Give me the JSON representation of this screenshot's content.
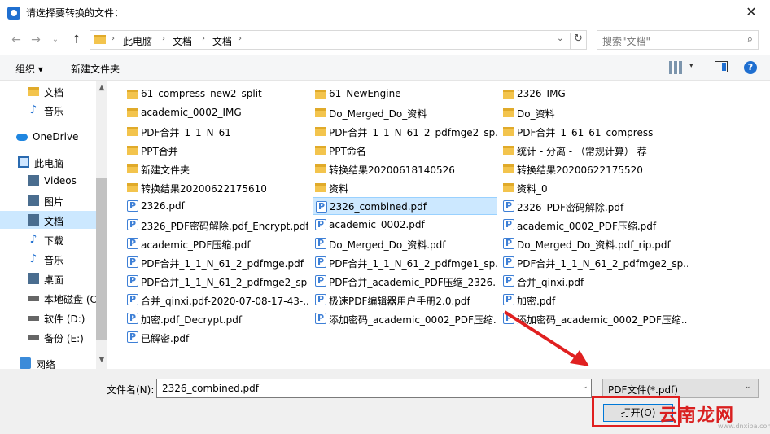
{
  "window": {
    "title": "请选择要转换的文件：",
    "close": "✕"
  },
  "address": {
    "crumbs": [
      "此电脑",
      "文档",
      "文档"
    ],
    "sep": "›",
    "dropdown": "⌄",
    "refresh": "↻"
  },
  "search": {
    "placeholder": "搜索\"文档\"",
    "icon": "⌕"
  },
  "toolbar": {
    "organize": "组织 ▾",
    "new_folder": "新建文件夹",
    "view_dd": "▾",
    "help": "?"
  },
  "nav": {
    "back": "←",
    "forward": "→",
    "up_dd": "⌄",
    "up": "↑"
  },
  "sidebar": {
    "items": [
      {
        "label": "文档",
        "icon": "folder-icon",
        "kind": "folder"
      },
      {
        "label": "音乐",
        "icon": "music-icon",
        "kind": "note"
      },
      {
        "label": "OneDrive",
        "icon": "cloud-icon",
        "kind": "cloud"
      },
      {
        "label": "此电脑",
        "icon": "computer-icon",
        "kind": "pc"
      },
      {
        "label": "Videos",
        "icon": "video-icon",
        "kind": "box"
      },
      {
        "label": "图片",
        "icon": "picture-icon",
        "kind": "box"
      },
      {
        "label": "文档",
        "icon": "document-icon",
        "kind": "box"
      },
      {
        "label": "下载",
        "icon": "download-icon",
        "kind": "note"
      },
      {
        "label": "音乐",
        "icon": "music-icon",
        "kind": "note"
      },
      {
        "label": "桌面",
        "icon": "desktop-icon",
        "kind": "box"
      },
      {
        "label": "本地磁盘 (C",
        "icon": "disk-icon",
        "kind": "disk"
      },
      {
        "label": "软件 (D:)",
        "icon": "disk-icon",
        "kind": "disk"
      },
      {
        "label": "备份 (E:)",
        "icon": "disk-icon",
        "kind": "disk"
      },
      {
        "label": "网络",
        "icon": "network-icon",
        "kind": "net"
      }
    ],
    "selected_index": 6
  },
  "files": {
    "col1": [
      {
        "name": "61_compress_new2_split",
        "type": "folder"
      },
      {
        "name": "academic_0002_IMG",
        "type": "folder"
      },
      {
        "name": "PDF合并_1_1_N_61",
        "type": "folder"
      },
      {
        "name": "PPT合并",
        "type": "folder"
      },
      {
        "name": "新建文件夹",
        "type": "folder"
      },
      {
        "name": "转换结果20200622175610",
        "type": "folder"
      },
      {
        "name": "2326.pdf",
        "type": "pdf"
      },
      {
        "name": "2326_PDF密码解除.pdf_Encrypt.pdf",
        "type": "pdf"
      },
      {
        "name": "academic_PDF压缩.pdf",
        "type": "pdf"
      },
      {
        "name": "PDF合并_1_1_N_61_2_pdfmge.pdf",
        "type": "pdf"
      },
      {
        "name": "PDF合并_1_1_N_61_2_pdfmge2_sp...",
        "type": "pdf"
      },
      {
        "name": "合并_qinxi.pdf-2020-07-08-17-43-...",
        "type": "pdf"
      },
      {
        "name": "加密.pdf_Decrypt.pdf",
        "type": "pdf"
      },
      {
        "name": "已解密.pdf",
        "type": "pdf"
      }
    ],
    "col2": [
      {
        "name": "61_NewEngine",
        "type": "folder"
      },
      {
        "name": "Do_Merged_Do_资料",
        "type": "folder"
      },
      {
        "name": "PDF合并_1_1_N_61_2_pdfmge2_sp...",
        "type": "folder"
      },
      {
        "name": "PPT命名",
        "type": "folder"
      },
      {
        "name": "转换结果20200618140526",
        "type": "folder"
      },
      {
        "name": "资料",
        "type": "folder"
      },
      {
        "name": "2326_combined.pdf",
        "type": "pdf",
        "selected": true
      },
      {
        "name": "academic_0002.pdf",
        "type": "pdf"
      },
      {
        "name": "Do_Merged_Do_资料.pdf",
        "type": "pdf"
      },
      {
        "name": "PDF合并_1_1_N_61_2_pdfmge1_sp...",
        "type": "pdf"
      },
      {
        "name": "PDF合并_academic_PDF压缩_2326...",
        "type": "pdf"
      },
      {
        "name": "极速PDF编辑器用户手册2.0.pdf",
        "type": "pdf"
      },
      {
        "name": "添加密码_academic_0002_PDF压缩...",
        "type": "pdf"
      }
    ],
    "col3": [
      {
        "name": "2326_IMG",
        "type": "folder"
      },
      {
        "name": "Do_资料",
        "type": "folder"
      },
      {
        "name": "PDF合并_1_61_61_compress",
        "type": "folder"
      },
      {
        "name": "统计 - 分离 - （常规计算） 荐",
        "type": "folder"
      },
      {
        "name": "转换结果20200622175520",
        "type": "folder"
      },
      {
        "name": "资料_0",
        "type": "folder"
      },
      {
        "name": "2326_PDF密码解除.pdf",
        "type": "pdf"
      },
      {
        "name": "academic_0002_PDF压缩.pdf",
        "type": "pdf"
      },
      {
        "name": "Do_Merged_Do_资料.pdf_rip.pdf",
        "type": "pdf"
      },
      {
        "name": "PDF合并_1_1_N_61_2_pdfmge2_sp...",
        "type": "pdf"
      },
      {
        "name": "合并_qinxi.pdf",
        "type": "pdf"
      },
      {
        "name": "加密.pdf",
        "type": "pdf"
      },
      {
        "name": "添加密码_academic_0002_PDF压缩...",
        "type": "pdf"
      }
    ]
  },
  "bottom": {
    "filename_label": "文件名(N):",
    "filename_value": "2326_combined.pdf",
    "filetype": "PDF文件(*.pdf)",
    "dd": "⌄",
    "open": "打开(O)"
  },
  "watermark": {
    "text": "云南龙网",
    "sub": "www.dnxiba.com"
  },
  "colors": {
    "accent": "#0078d7",
    "selection": "#cce8ff",
    "annotation": "#e02020",
    "folder": "#f3c44d"
  }
}
